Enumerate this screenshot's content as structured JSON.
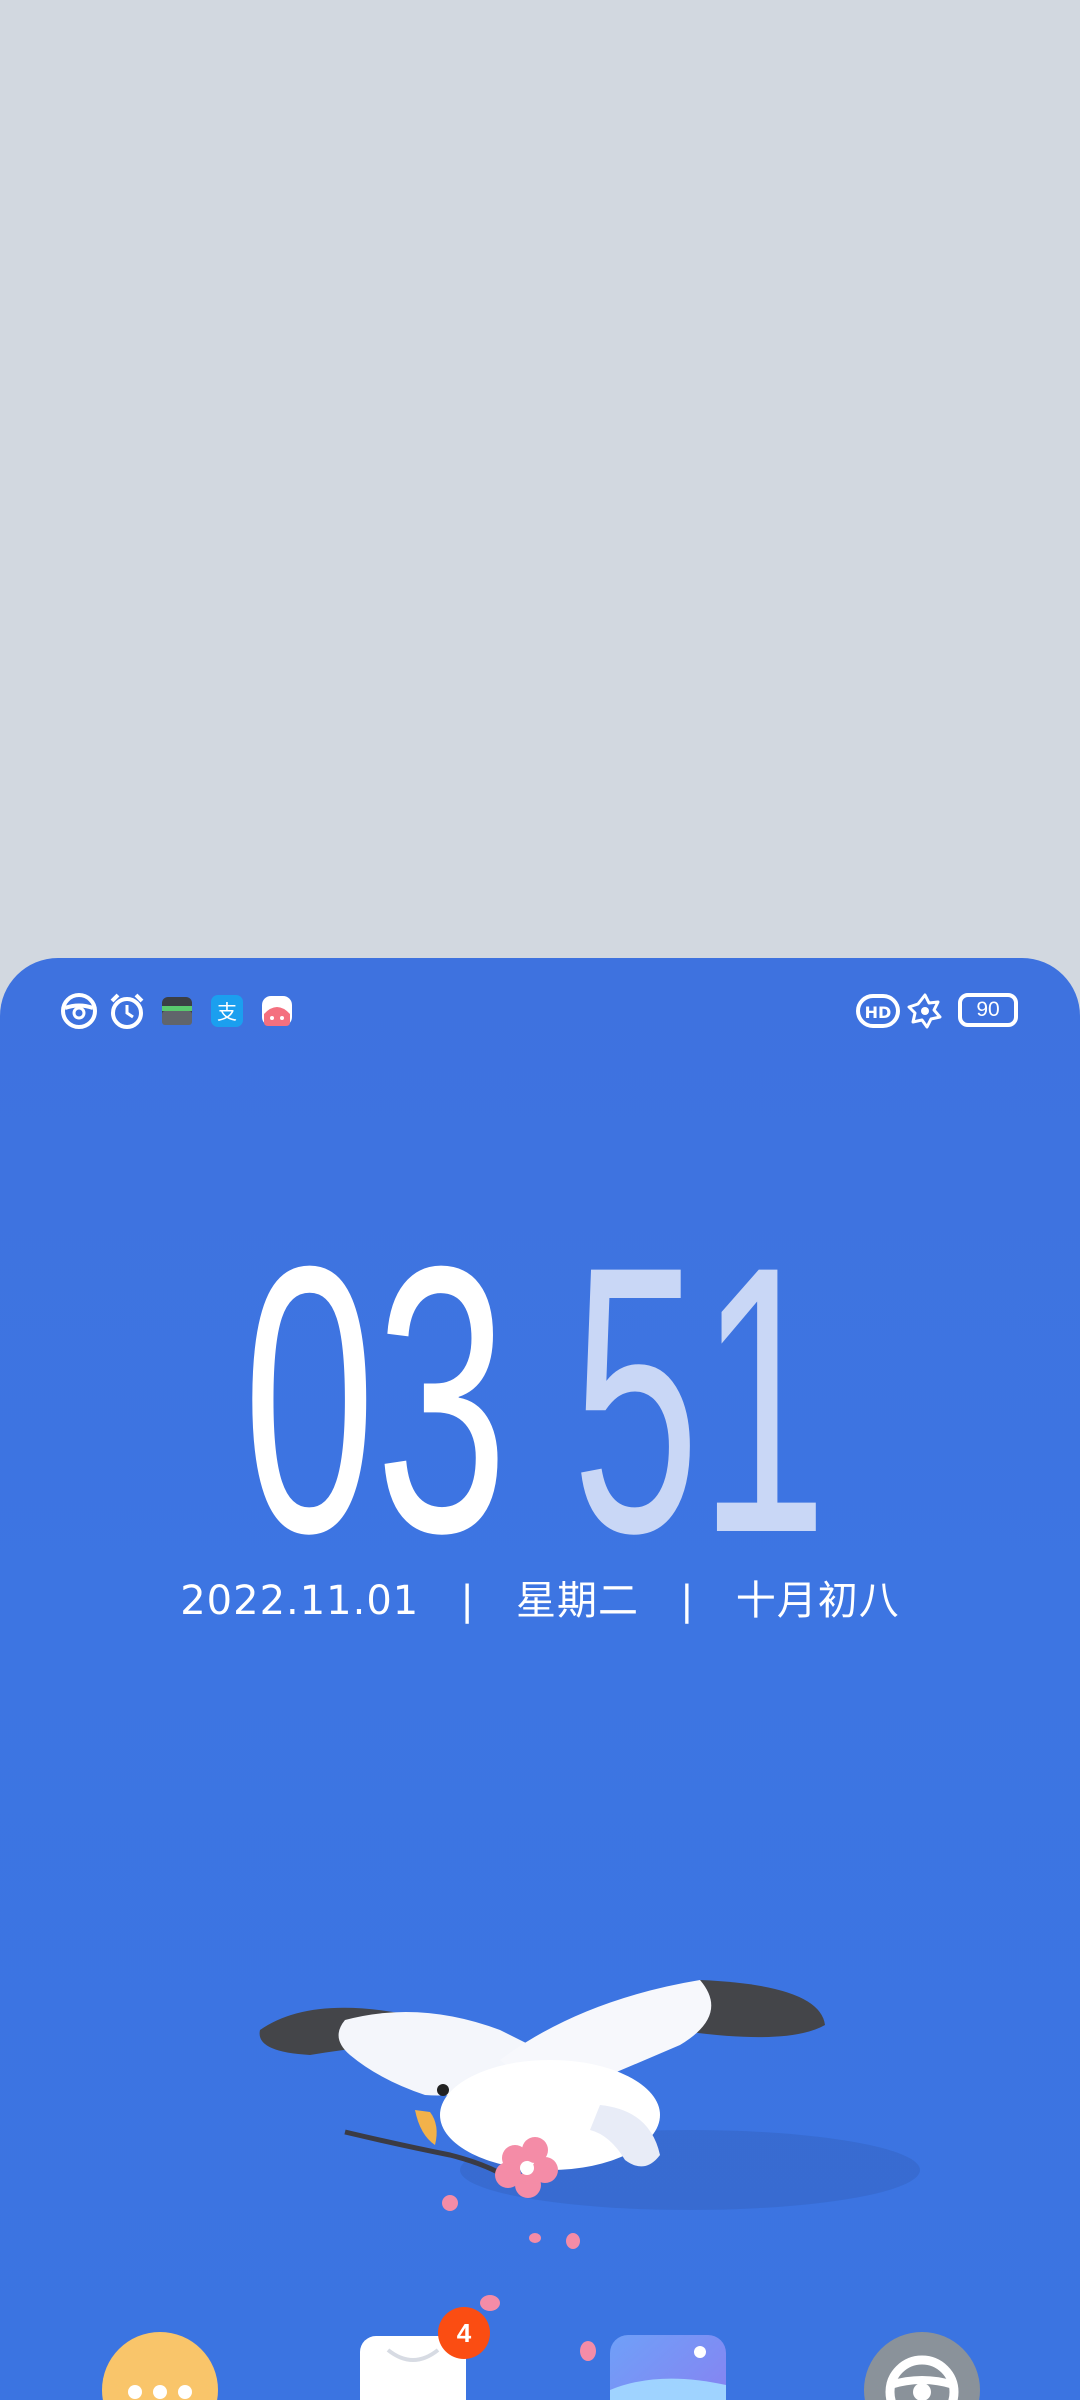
{
  "status_bar": {
    "left_icons": [
      "steering-wheel-icon",
      "alarm-clock-icon",
      "wallet-icon",
      "alipay-icon",
      "pink-app-icon"
    ],
    "right_icons": [
      "hd-icon",
      "flower-icon",
      "battery-icon"
    ],
    "battery_level": "90"
  },
  "lockscreen": {
    "hour": "03",
    "minute": "51",
    "date_line": "2022.11.01   |   星期二   |   十月初八"
  },
  "dock": {
    "apps": [
      "more-app-icon",
      "mall-app-icon",
      "gallery-app-icon",
      "settings-app-icon"
    ],
    "badge_count": "4"
  },
  "colors": {
    "wallpaper_blue": "#3d74e1",
    "top_gray": "#d2d8e0",
    "minute_color": "#c9d7f6",
    "badge_orange": "#fb4d12"
  }
}
